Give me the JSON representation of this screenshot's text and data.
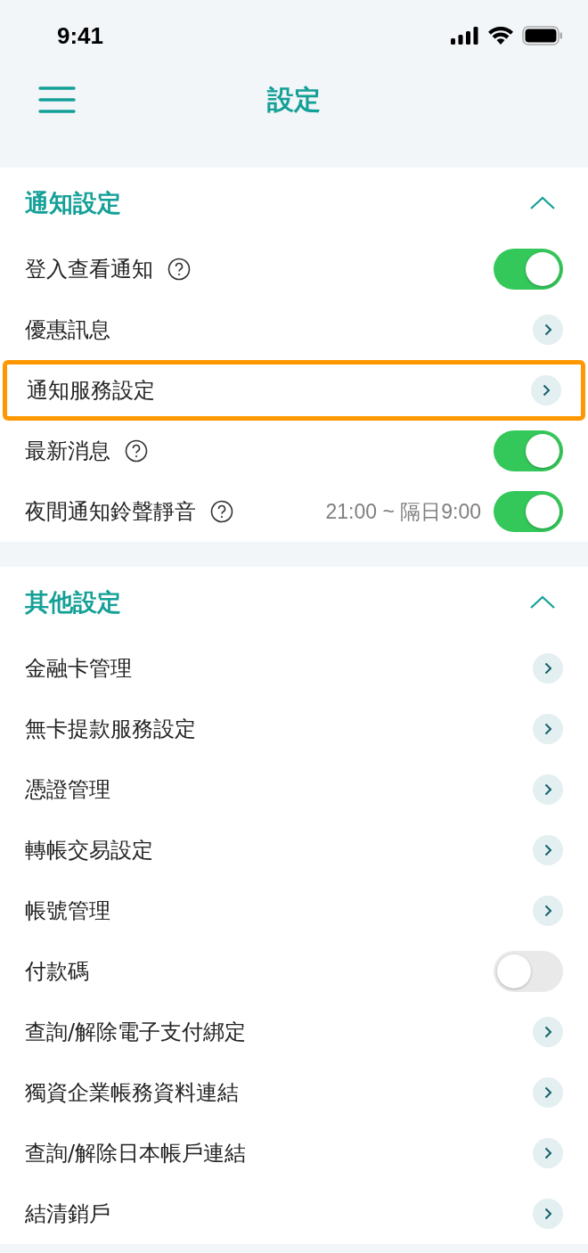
{
  "status_bar": {
    "time": "9:41"
  },
  "header": {
    "title": "設定"
  },
  "sections": [
    {
      "title": "通知設定",
      "expanded": true,
      "items": [
        {
          "label": "登入查看通知",
          "kind": "toggle",
          "on": true,
          "help": true,
          "highlighted": false
        },
        {
          "label": "優惠訊息",
          "kind": "link",
          "help": false,
          "highlighted": false
        },
        {
          "label": "通知服務設定",
          "kind": "link",
          "help": false,
          "highlighted": true
        },
        {
          "label": "最新消息",
          "kind": "toggle",
          "on": true,
          "help": true,
          "highlighted": false
        },
        {
          "label": "夜間通知鈴聲靜音",
          "kind": "toggle",
          "on": true,
          "help": true,
          "note": "21:00 ~ 隔日9:00",
          "highlighted": false
        }
      ]
    },
    {
      "title": "其他設定",
      "expanded": true,
      "items": [
        {
          "label": "金融卡管理",
          "kind": "link",
          "help": false,
          "highlighted": false
        },
        {
          "label": "無卡提款服務設定",
          "kind": "link",
          "help": false,
          "highlighted": false
        },
        {
          "label": "憑證管理",
          "kind": "link",
          "help": false,
          "highlighted": false
        },
        {
          "label": "轉帳交易設定",
          "kind": "link",
          "help": false,
          "highlighted": false
        },
        {
          "label": "帳號管理",
          "kind": "link",
          "help": false,
          "highlighted": false
        },
        {
          "label": "付款碼",
          "kind": "toggle",
          "on": false,
          "help": false,
          "highlighted": false
        },
        {
          "label": "查詢/解除電子支付綁定",
          "kind": "link",
          "help": false,
          "highlighted": false
        },
        {
          "label": "獨資企業帳務資料連結",
          "kind": "link",
          "help": false,
          "highlighted": false
        },
        {
          "label": "查詢/解除日本帳戶連結",
          "kind": "link",
          "help": false,
          "highlighted": false
        },
        {
          "label": "結清銷戶",
          "kind": "link",
          "help": false,
          "highlighted": false
        }
      ]
    }
  ]
}
